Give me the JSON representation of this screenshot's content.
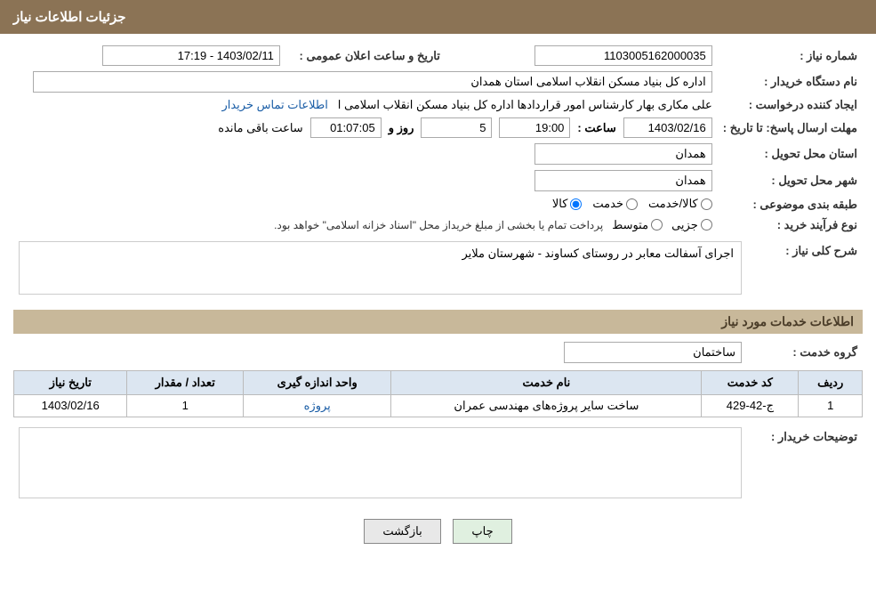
{
  "header": {
    "title": "جزئیات اطلاعات نیاز"
  },
  "fields": {
    "shenmare_niaz_label": "شماره نیاز :",
    "shenmare_niaz_value": "1103005162000035",
    "name_dastgah_label": "نام دستگاه خریدار :",
    "name_dastgah_value": "اداره کل بنیاد مسکن انقلاب اسلامی استان همدان",
    "ijad_konande_label": "ایجاد کننده درخواست :",
    "ijad_konande_value": "علی مکاری بهار کارشناس امور قراردادها اداره کل بنیاد مسکن انقلاب اسلامی ا",
    "ijad_konande_link": "اطلاعات تماس خریدار",
    "mohlat_label": "مهلت ارسال پاسخ: تا تاریخ :",
    "tarikh_value": "1403/02/16",
    "saat_label": "ساعت :",
    "saat_value": "19:00",
    "rooz_label": "روز و",
    "rooz_value": "5",
    "saat_mande_label": "ساعت باقی مانده",
    "saat_mande_value": "01:07:05",
    "ostan_tahvil_label": "استان محل تحویل :",
    "ostan_tahvil_value": "همدان",
    "shahr_tahvil_label": "شهر محل تحویل :",
    "shahr_tahvil_value": "همدان",
    "tarifbandi_label": "طبقه بندی موضوعی :",
    "tarifbandi_kala": "کالا",
    "tarifbandi_khedmat": "خدمت",
    "tarifbandi_kala_khedmat": "کالا/خدمت",
    "nooe_farayand_label": "نوع فرآیند خرید :",
    "nooe_jozvi": "جزیی",
    "nooe_motavaset": "متوسط",
    "nooe_description": "پرداخت تمام یا بخشی از مبلغ خریداز محل \"اسناد خزانه اسلامی\" خواهد بود.",
    "sharh_niaz_label": "شرح کلی نیاز :",
    "sharh_niaz_value": "اجرای آسفالت معابر در روستای کساوند -  شهرستان ملایر",
    "khadamat_section_title": "اطلاعات خدمات مورد نیاز",
    "goroh_khedmat_label": "گروه خدمت :",
    "goroh_khedmat_value": "ساختمان",
    "table_headers": {
      "radif": "ردیف",
      "kod_khedmat": "کد خدمت",
      "name_khedmat": "نام خدمت",
      "vahed": "واحد اندازه گیری",
      "tedad": "تعداد / مقدار",
      "tarikh_niaz": "تاریخ نیاز"
    },
    "table_rows": [
      {
        "radif": "1",
        "kod_khedmat": "ج-42-429",
        "name_khedmat": "ساخت سایر پروژه‌های مهندسی عمران",
        "vahed": "پروژه",
        "tedad": "1",
        "tarikh_niaz": "1403/02/16"
      }
    ],
    "tosifat_label": "توضیحات خریدار :",
    "tarikh_elaan_label": "تاریخ و ساعت اعلان عمومی :",
    "tarikh_elaan_value": "1403/02/11 - 17:19"
  },
  "buttons": {
    "print_label": "چاپ",
    "back_label": "بازگشت"
  }
}
